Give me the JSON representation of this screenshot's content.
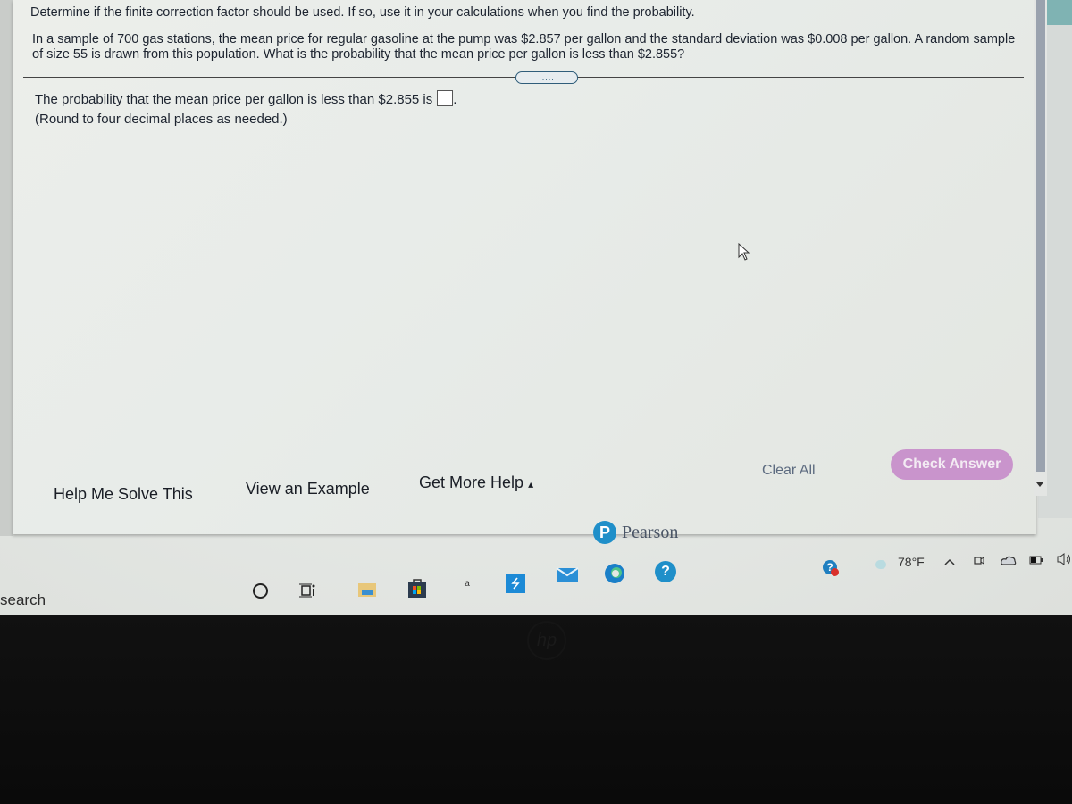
{
  "question": {
    "instruction": "Determine if the finite correction factor should be used. If so, use it in your calculations when you find the probability.",
    "text": "In a sample of 700 gas stations, the mean price for regular gasoline at the pump was $2.857 per gallon and the standard deviation was $0.008 per gallon. A random sample of size 55 is drawn from this population. What is the probability that the mean price per gallon is less than $2.855?",
    "more_indicator": ".....",
    "answer_prefix": "The probability that the mean price per gallon is less than $2.855 is",
    "answer_value": "",
    "answer_suffix": ".",
    "round_note": "(Round to four decimal places as needed.)"
  },
  "help_buttons": {
    "help_me_solve": "Help Me Solve This",
    "view_example": "View an Example",
    "get_more_help": "Get More Help",
    "get_more_help_arrow": "▴"
  },
  "actions": {
    "clear_all": "Clear All",
    "check_answer": "Check Answer"
  },
  "branding": {
    "logo_letter": "P",
    "name": "Pearson"
  },
  "taskbar": {
    "search_label": "search",
    "weather": "78°F",
    "icons": [
      "cortana-icon",
      "task-view-icon",
      "file-explorer-icon",
      "microsoft-store-icon",
      "amazon-icon",
      "app-icon",
      "mail-icon",
      "edge-icon",
      "help-icon"
    ],
    "tray_icons": [
      "help-alert-icon",
      "weather-icon",
      "chevron-up-icon",
      "meet-now-icon",
      "onedrive-icon",
      "battery-icon",
      "volume-icon"
    ]
  },
  "colors": {
    "check_answer_bg": "#c994cc",
    "pearson_blue": "#1f8fc9"
  },
  "bezel_logo": "hp"
}
